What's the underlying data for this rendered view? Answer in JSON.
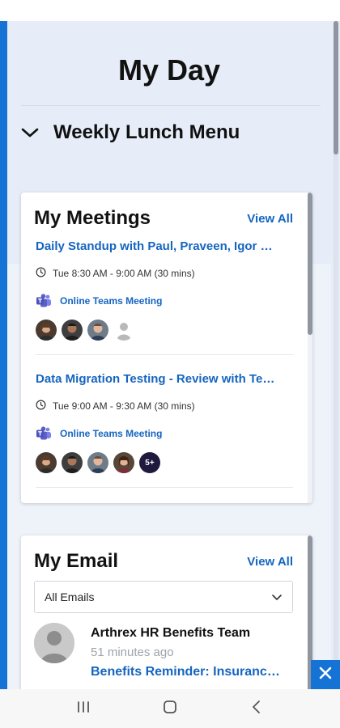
{
  "header": {
    "title": "My Day"
  },
  "lunch_section": {
    "label": "Weekly Lunch Menu",
    "icon": "chevron-down-icon"
  },
  "meetings": {
    "title": "My Meetings",
    "view_all": "View All",
    "items": [
      {
        "title": "Daily Standup with Paul, Praveen, Igor & Marcus",
        "time": "Tue 8:30 AM - 9:00 AM (30 mins)",
        "online_label": "Online Teams Meeting",
        "attendee_overflow": ""
      },
      {
        "title": "Data Migration Testing - Review with Test Team",
        "time": "Tue 9:00 AM - 9:30 AM (30 mins)",
        "online_label": "Online Teams Meeting",
        "attendee_overflow": "5+"
      }
    ]
  },
  "email": {
    "title": "My Email",
    "view_all": "View All",
    "filter": {
      "selected": "All Emails"
    },
    "items": [
      {
        "sender": "Arthrex HR Benefits Team",
        "time_ago": "51 minutes ago",
        "subject": "Benefits Reminder: Insurance Enrollment"
      }
    ]
  },
  "colors": {
    "accent": "#1573d6",
    "link": "#1565c0",
    "page_bg": "#e6edf8",
    "teams_purple": "#5b5fc7"
  }
}
